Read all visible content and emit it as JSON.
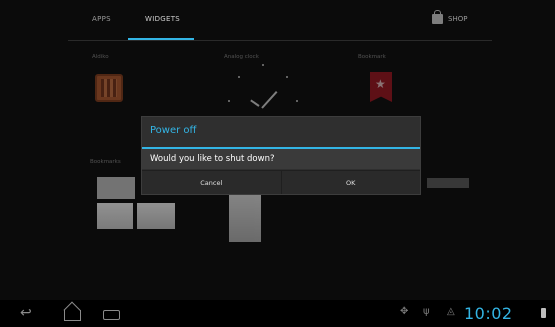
{
  "tabs": {
    "apps": "APPS",
    "widgets": "WIDGETS",
    "shop": "SHOP"
  },
  "widgets": {
    "ankle_label": "Aldiko",
    "clock_label": "Analog clock",
    "bookmark_label": "Bookmark",
    "bookmarks_label": "Bookmarks"
  },
  "dialog": {
    "title": "Power off",
    "message": "Would you like to shut down?",
    "cancel": "Cancel",
    "ok": "OK"
  },
  "status_bar": {
    "time": "10:02"
  },
  "colors": {
    "accent": "#33b5e5",
    "dialog_bg": "#2f2f2f",
    "bookmark_red": "#a3151f"
  },
  "icons": {
    "shop": "shop-bag-icon",
    "back": "back-icon",
    "home": "home-icon",
    "recent": "recent-apps-icon",
    "usb": "usb-icon",
    "signal": "signal-icon",
    "wifi": "wifi-icon",
    "battery": "battery-icon"
  }
}
